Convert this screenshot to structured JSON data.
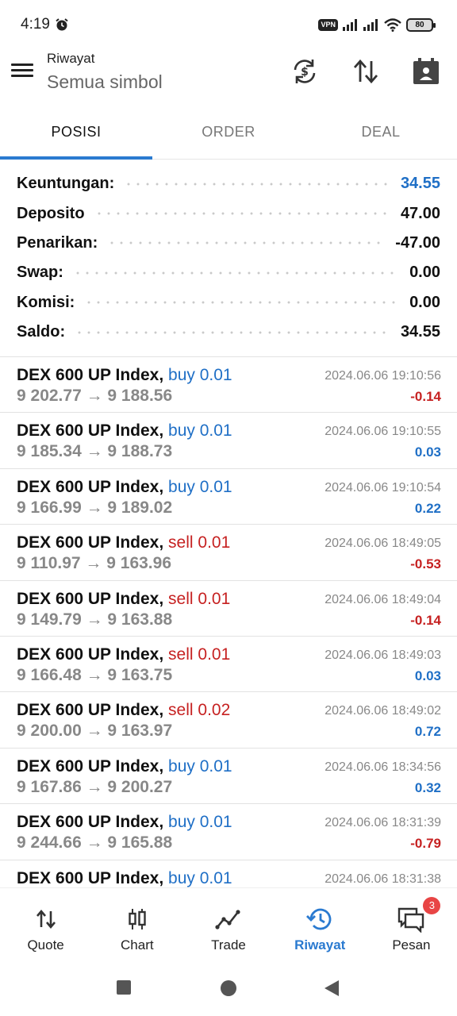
{
  "status_bar": {
    "time": "4:19",
    "vpn": "VPN",
    "battery": "80"
  },
  "app_bar": {
    "title": "Riwayat",
    "subtitle": "Semua simbol",
    "icons": [
      "menu-icon",
      "currency-exchange-icon",
      "sort-icon",
      "calendar-person-icon"
    ]
  },
  "tabs": [
    {
      "label": "POSISI",
      "active": true
    },
    {
      "label": "ORDER",
      "active": false
    },
    {
      "label": "DEAL",
      "active": false
    }
  ],
  "summary": [
    {
      "label": "Keuntungan:",
      "value": "34.55",
      "highlight": true
    },
    {
      "label": "Deposito",
      "value": "47.00"
    },
    {
      "label": "Penarikan:",
      "value": "-47.00"
    },
    {
      "label": "Swap:",
      "value": "0.00"
    },
    {
      "label": "Komisi:",
      "value": "0.00"
    },
    {
      "label": "Saldo:",
      "value": "34.55"
    }
  ],
  "deals": [
    {
      "symbol": "DEX 600 UP Index,",
      "side": "buy",
      "volume_text": "buy 0.01",
      "prices": "9 202.77 → 9 188.56",
      "time": "2024.06.06 19:10:56",
      "profit": "-0.14"
    },
    {
      "symbol": "DEX 600 UP Index,",
      "side": "buy",
      "volume_text": "buy 0.01",
      "prices": "9 185.34 → 9 188.73",
      "time": "2024.06.06 19:10:55",
      "profit": "0.03"
    },
    {
      "symbol": "DEX 600 UP Index,",
      "side": "buy",
      "volume_text": "buy 0.01",
      "prices": "9 166.99 → 9 189.02",
      "time": "2024.06.06 19:10:54",
      "profit": "0.22"
    },
    {
      "symbol": "DEX 600 UP Index,",
      "side": "sell",
      "volume_text": "sell 0.01",
      "prices": "9 110.97 → 9 163.96",
      "time": "2024.06.06 18:49:05",
      "profit": "-0.53"
    },
    {
      "symbol": "DEX 600 UP Index,",
      "side": "sell",
      "volume_text": "sell 0.01",
      "prices": "9 149.79 → 9 163.88",
      "time": "2024.06.06 18:49:04",
      "profit": "-0.14"
    },
    {
      "symbol": "DEX 600 UP Index,",
      "side": "sell",
      "volume_text": "sell 0.01",
      "prices": "9 166.48 → 9 163.75",
      "time": "2024.06.06 18:49:03",
      "profit": "0.03"
    },
    {
      "symbol": "DEX 600 UP Index,",
      "side": "sell",
      "volume_text": "sell 0.02",
      "prices": "9 200.00 → 9 163.97",
      "time": "2024.06.06 18:49:02",
      "profit": "0.72"
    },
    {
      "symbol": "DEX 600 UP Index,",
      "side": "buy",
      "volume_text": "buy 0.01",
      "prices": "9 167.86 → 9 200.27",
      "time": "2024.06.06 18:34:56",
      "profit": "0.32"
    },
    {
      "symbol": "DEX 600 UP Index,",
      "side": "buy",
      "volume_text": "buy 0.01",
      "prices": "9 244.66 → 9 165.88",
      "time": "2024.06.06 18:31:39",
      "profit": "-0.79"
    },
    {
      "symbol": "DEX 600 UP Index,",
      "side": "buy",
      "volume_text": "buy 0.01",
      "prices": "",
      "time": "2024.06.06 18:31:38",
      "profit": ""
    }
  ],
  "bottom_nav": [
    {
      "label": "Quote",
      "icon": "quote-arrows-icon",
      "active": false
    },
    {
      "label": "Chart",
      "icon": "candlestick-chart-icon",
      "active": false
    },
    {
      "label": "Trade",
      "icon": "trade-line-icon",
      "active": false
    },
    {
      "label": "Riwayat",
      "icon": "history-icon",
      "active": true
    },
    {
      "label": "Pesan",
      "icon": "messages-icon",
      "active": false,
      "badge": "3"
    }
  ],
  "colors": {
    "accent": "#2a7ad0",
    "buy": "#1f6fc6",
    "sell": "#c62121",
    "badge": "#e84545"
  }
}
